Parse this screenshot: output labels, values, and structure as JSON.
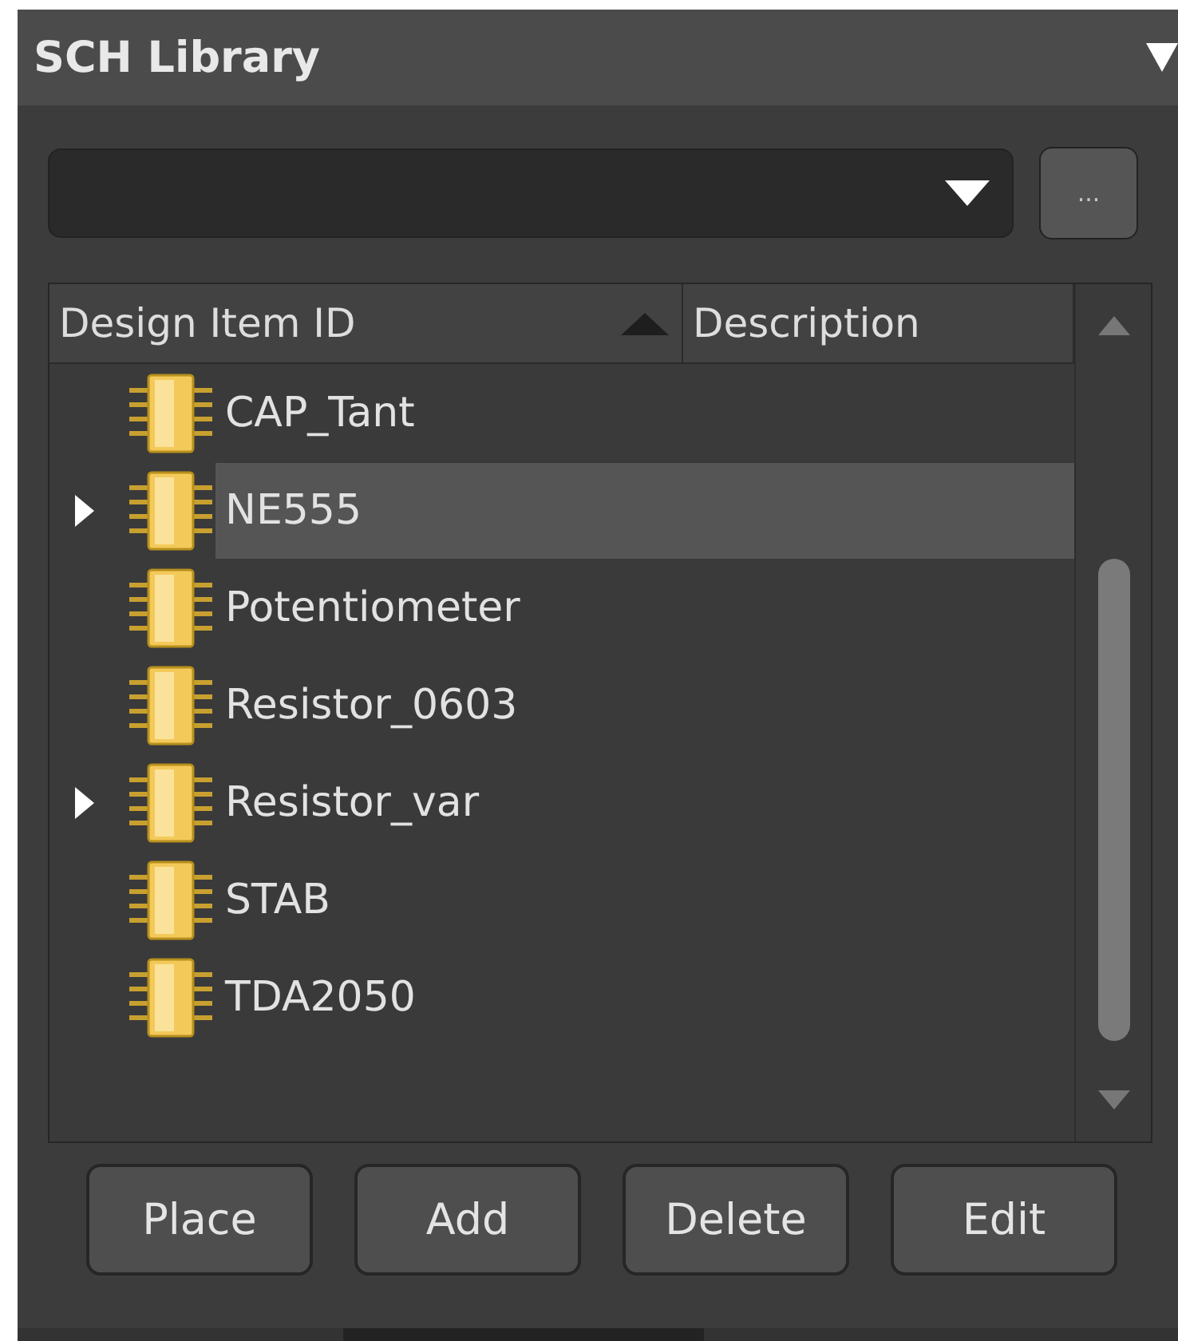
{
  "panel": {
    "title": "SCH Library"
  },
  "browse_button": {
    "label": "..."
  },
  "table": {
    "columns": [
      {
        "label": "Design Item ID",
        "sorted": true
      },
      {
        "label": "Description",
        "sorted": false
      }
    ],
    "rows": [
      {
        "name": "CAP_Tant",
        "expandable": false,
        "selected": false
      },
      {
        "name": "NE555",
        "expandable": true,
        "selected": true
      },
      {
        "name": "Potentiometer",
        "expandable": false,
        "selected": false
      },
      {
        "name": "Resistor_0603",
        "expandable": false,
        "selected": false
      },
      {
        "name": "Resistor_var",
        "expandable": true,
        "selected": false
      },
      {
        "name": "STAB",
        "expandable": false,
        "selected": false
      },
      {
        "name": "TDA2050",
        "expandable": false,
        "selected": false
      }
    ]
  },
  "buttons": [
    "Place",
    "Add",
    "Delete",
    "Edit"
  ]
}
